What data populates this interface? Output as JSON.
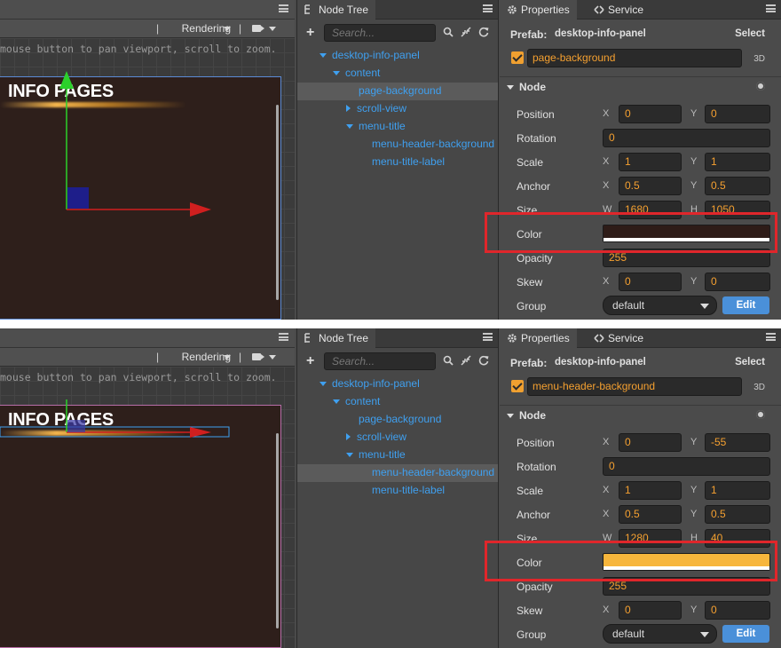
{
  "panels": {
    "scene": {
      "rendering_label": "Rendering",
      "separator": "|",
      "hint": "mouse button to pan viewport, scroll to zoom.",
      "canvas_title": "INFO PAGES"
    },
    "node_tree": {
      "tab_label": "Node Tree",
      "search_placeholder": "Search..."
    },
    "properties": {
      "tab_label": "Properties",
      "service_tab_label": "Service",
      "prefab_label": "Prefab:",
      "prefab_name": "desktop-info-panel",
      "select_label": "Select",
      "three_d_label": "3D",
      "node_section_label": "Node",
      "labels": {
        "position": "Position",
        "rotation": "Rotation",
        "scale": "Scale",
        "anchor": "Anchor",
        "size": "Size",
        "color": "Color",
        "opacity": "Opacity",
        "skew": "Skew",
        "group": "Group"
      },
      "axes": {
        "x": "X",
        "y": "Y",
        "w": "W",
        "h": "H"
      },
      "edit_label": "Edit"
    }
  },
  "tree_items": {
    "root": "desktop-info-panel",
    "content": "content",
    "page_background": "page-background",
    "scroll_view": "scroll-view",
    "menu_title": "menu-title",
    "menu_header_background": "menu-header-background",
    "menu_title_label": "menu-title-label"
  },
  "shot1": {
    "selected_node": "page-background",
    "position": {
      "x": "0",
      "y": "0"
    },
    "rotation": "0",
    "scale": {
      "x": "1",
      "y": "1"
    },
    "anchor": {
      "x": "0.5",
      "y": "0.5"
    },
    "size": {
      "w": "1680",
      "h": "1050"
    },
    "color": "#2e1c18",
    "opacity": "255",
    "skew": {
      "x": "0",
      "y": "0"
    },
    "group": "default"
  },
  "shot2": {
    "selected_node": "menu-header-background",
    "position": {
      "x": "0",
      "y": "-55"
    },
    "rotation": "0",
    "scale": {
      "x": "1",
      "y": "1"
    },
    "anchor": {
      "x": "0.5",
      "y": "0.5"
    },
    "size": {
      "w": "1280",
      "h": "40"
    },
    "color": "#f7b63c",
    "opacity": "255",
    "skew": {
      "x": "0",
      "y": "0"
    },
    "group": "default"
  },
  "colors": {
    "accent_blue": "#3fa0f0",
    "value_orange": "#f5a030",
    "highlight_red": "#e0262b",
    "edit_button": "#4a90d9"
  }
}
